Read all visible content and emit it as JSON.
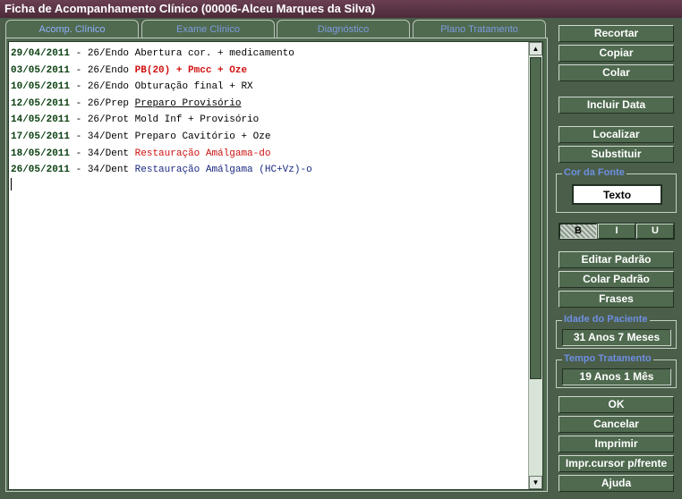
{
  "window": {
    "title": "Ficha de Acompanhamento Clínico (00006-Alceu Marques da Silva)"
  },
  "tabs": [
    {
      "label": "Acomp. Clínico",
      "active": true
    },
    {
      "label": "Exame Clínico",
      "active": false
    },
    {
      "label": "Diagnóstico",
      "active": false
    },
    {
      "label": "Plano Tratamento",
      "active": false
    }
  ],
  "entries": [
    {
      "date": "29/04/2011",
      "sep": " - ",
      "code": "26/Endo ",
      "text": "Abertura cor. + medicamento",
      "style": "normal"
    },
    {
      "date": "03/05/2011",
      "sep": " - ",
      "code": "26/Endo ",
      "text": "PB(20) + Pmcc + Oze",
      "style": "red-bold"
    },
    {
      "date": "10/05/2011",
      "sep": " - ",
      "code": "26/Endo ",
      "text": "Obturação final + RX",
      "style": "normal"
    },
    {
      "date": "12/05/2011",
      "sep": " - ",
      "code": "26/Prep ",
      "text": "Preparo Provisório",
      "style": "underline"
    },
    {
      "date": "14/05/2011",
      "sep": " - ",
      "code": "26/Prot ",
      "text": "Mold Inf + Provisório",
      "style": "normal"
    },
    {
      "date": "17/05/2011",
      "sep": " - ",
      "code": "34/Dent ",
      "text": "Preparo Cavitório + Oze",
      "style": "normal"
    },
    {
      "date": "18/05/2011",
      "sep": " - ",
      "code": "34/Dent ",
      "text": "Restauração Amálgama-do",
      "style": "red"
    },
    {
      "date": "26/05/2011",
      "sep": " - ",
      "code": "34/Dent ",
      "text": "Restauração Amálgama (HC+Vz)-o",
      "style": "blue"
    }
  ],
  "scroll": {
    "up": "▲",
    "down": "▼"
  },
  "buttons": {
    "recortar": "Recortar",
    "copiar": "Copiar",
    "colar": "Colar",
    "incluir_data": "Incluir Data",
    "localizar": "Localizar",
    "substituir": "Substituir",
    "editar_padrao": "Editar Padrão",
    "colar_padrao": "Colar Padrão",
    "frases": "Frases",
    "ok": "OK",
    "cancelar": "Cancelar",
    "imprimir": "Imprimir",
    "impr_cursor": "Impr.cursor p/frente",
    "ajuda": "Ajuda"
  },
  "cor_da_fonte": {
    "label": "Cor da Fonte",
    "value": "Texto"
  },
  "format": {
    "bold": "B",
    "italic": "I",
    "underline": "U",
    "bold_active": true
  },
  "idade": {
    "label": "Idade do Paciente",
    "value": "31 Anos 7 Meses"
  },
  "tempo": {
    "label": "Tempo Tratamento",
    "value": "19 Anos 1 Mês"
  },
  "colors": {
    "title_bar": "#5a3446",
    "panel": "#4f6a4f",
    "label_blue": "#6e8fe0",
    "date_green": "#0a3f10",
    "red_text": "#d01010",
    "blue_text": "#1a2a80"
  }
}
